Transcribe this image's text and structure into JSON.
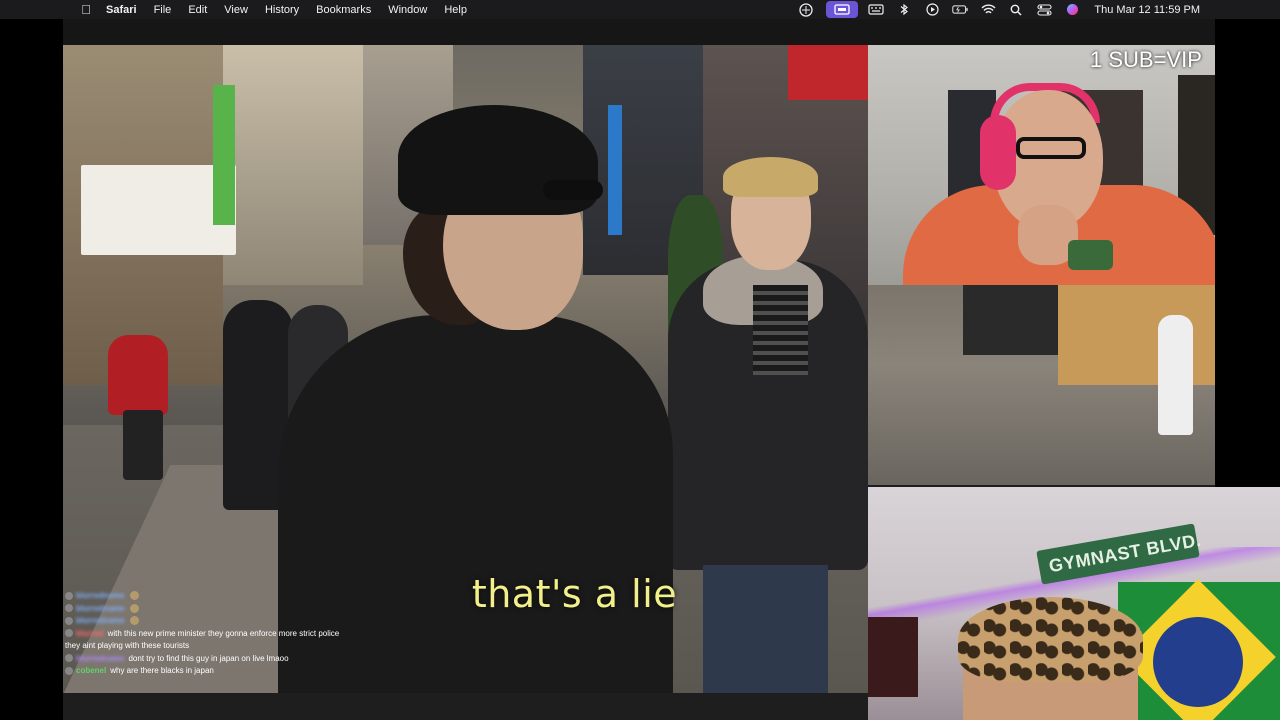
{
  "menubar": {
    "app": "Safari",
    "items": [
      "File",
      "Edit",
      "View",
      "History",
      "Bookmarks",
      "Window",
      "Help"
    ],
    "clock": "Thu Mar 12  11:59 PM",
    "status_icons": [
      "vpn-icon",
      "screen-mirror-icon",
      "keyboard-icon",
      "bluetooth-icon",
      "play-icon",
      "battery-icon",
      "wifi-icon",
      "search-icon",
      "control-center-icon",
      "siri-icon"
    ]
  },
  "stream": {
    "caption": "that's a lie",
    "overlay_text": "1 SUB=VIP",
    "banner_text": "GYMNAST BLVD."
  },
  "chat": {
    "lines": [
      {
        "name": "blurredname",
        "text": "",
        "color": "#7fb2ff"
      },
      {
        "name": "blurredname",
        "text": "",
        "color": "#7fb2ff"
      },
      {
        "name": "blurredname",
        "text": "",
        "color": "#7fb2ff"
      },
      {
        "name": "blurred",
        "text": "with this new prime minister they gonna enforce more strict police",
        "color": "#ff6b6b"
      },
      {
        "name": "",
        "text": "they aint playing with these tourists",
        "color": "#ffffff"
      },
      {
        "name": "blurredname",
        "text": "dont try to find this guy in japan on live lmaoo",
        "color": "#b08cff"
      },
      {
        "name": "cobenel",
        "text": "why are there blacks in japan",
        "color": "#63d16b"
      }
    ]
  }
}
